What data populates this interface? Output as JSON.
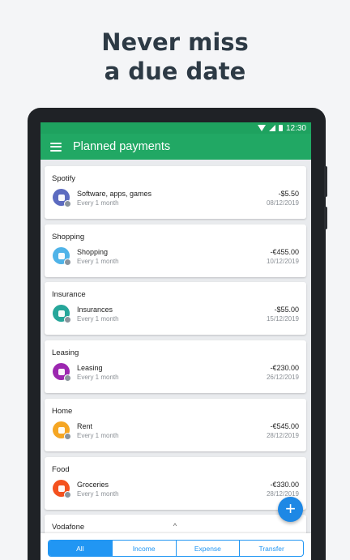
{
  "headline": {
    "line1": "Never miss",
    "line2": "a due date"
  },
  "statusbar": {
    "time": "12:30"
  },
  "appbar": {
    "title": "Planned payments"
  },
  "payments": [
    {
      "group": "Spotify",
      "name": "Software, apps, games",
      "frequency": "Every 1 month",
      "amount": "-$5.50",
      "date": "08/12/2019",
      "color": "#5c6bc0",
      "icon": "app-store-icon"
    },
    {
      "group": "Shopping",
      "name": "Shopping",
      "frequency": "Every 1 month",
      "amount": "-€455.00",
      "date": "10/12/2019",
      "color": "#4fb3e8",
      "icon": "shopping-bag-icon"
    },
    {
      "group": "Insurance",
      "name": "Insurances",
      "frequency": "Every 1 month",
      "amount": "-$55.00",
      "date": "15/12/2019",
      "color": "#26a69a",
      "icon": "insurance-card-icon"
    },
    {
      "group": "Leasing",
      "name": "Leasing",
      "frequency": "Every 1 month",
      "amount": "-€230.00",
      "date": "26/12/2019",
      "color": "#9c27b0",
      "icon": "car-icon"
    },
    {
      "group": "Home",
      "name": "Rent",
      "frequency": "Every 1 month",
      "amount": "-€545.00",
      "date": "28/12/2019",
      "color": "#f5a623",
      "icon": "key-icon"
    },
    {
      "group": "Food",
      "name": "Groceries",
      "frequency": "Every 1 month",
      "amount": "-€330.00",
      "date": "28/12/2019",
      "color": "#f4511e",
      "icon": "groceries-icon"
    }
  ],
  "partial": {
    "group": "Vodafone"
  },
  "fab": {
    "label": "+"
  },
  "handle": {
    "label": "^"
  },
  "tabs": [
    {
      "label": "All",
      "active": true
    },
    {
      "label": "Income",
      "active": false
    },
    {
      "label": "Expense",
      "active": false
    },
    {
      "label": "Transfer",
      "active": false
    }
  ]
}
